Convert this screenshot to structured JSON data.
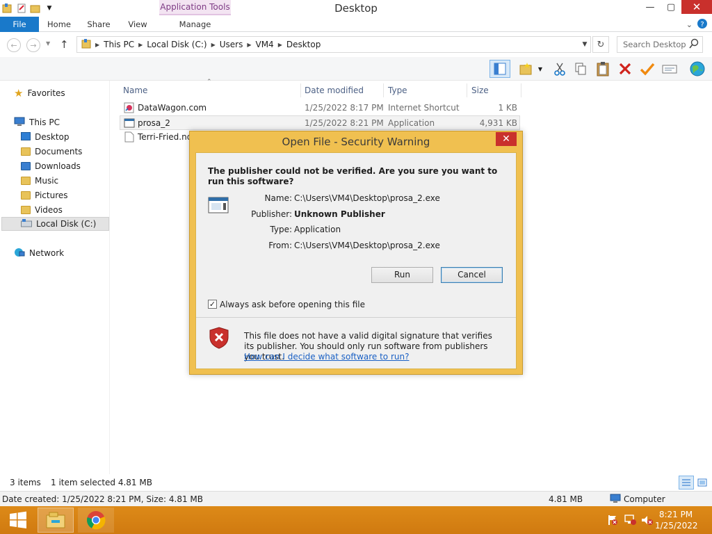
{
  "window": {
    "title": "Desktop",
    "app_tools_label": "Application Tools",
    "controls": {
      "minimize": "—",
      "restore": "▢",
      "close": "✕"
    }
  },
  "ribbon": {
    "tabs": [
      "File",
      "Home",
      "Share",
      "View",
      "Manage"
    ]
  },
  "address": {
    "crumbs": [
      "This PC",
      "Local Disk (C:)",
      "Users",
      "VM4",
      "Desktop"
    ],
    "search_placeholder": "Search Desktop"
  },
  "nav": {
    "favorites": "Favorites",
    "this_pc": "This PC",
    "items": [
      "Desktop",
      "Documents",
      "Downloads",
      "Music",
      "Pictures",
      "Videos",
      "Local Disk (C:)"
    ],
    "network": "Network"
  },
  "files": {
    "headers": [
      "Name",
      "Date modified",
      "Type",
      "Size"
    ],
    "rows": [
      {
        "name": "DataWagon.com",
        "date": "1/25/2022 8:17 PM",
        "type": "Internet Shortcut",
        "size": "1 KB"
      },
      {
        "name": "prosa_2",
        "date": "1/25/2022 8:21 PM",
        "type": "Application",
        "size": "4,931 KB"
      },
      {
        "name": "Terri-Fried.nds",
        "date": "",
        "type": "",
        "size": ""
      }
    ]
  },
  "status": {
    "item_count": "3 items",
    "selection": "1 item selected  4.81 MB",
    "details": "Date created: 1/25/2022 8:21 PM, Size: 4.81 MB",
    "size": "4.81 MB",
    "location": "Computer"
  },
  "taskbar": {
    "time": "8:21 PM",
    "date": "1/25/2022"
  },
  "dialog": {
    "title": "Open File - Security Warning",
    "heading": "The publisher could not be verified.  Are you sure you want to run this software?",
    "fields": [
      {
        "label": "Name:",
        "value": "C:\\Users\\VM4\\Desktop\\prosa_2.exe"
      },
      {
        "label": "Publisher:",
        "value": "Unknown Publisher"
      },
      {
        "label": "Type:",
        "value": "Application"
      },
      {
        "label": "From:",
        "value": "C:\\Users\\VM4\\Desktop\\prosa_2.exe"
      }
    ],
    "run_label": "Run",
    "cancel_label": "Cancel",
    "checkbox_label": "Always ask before opening this file",
    "checkbox_checked": true,
    "warning_text": "This file does not have a valid digital signature that verifies its publisher.  You should only run software from publishers you trust.",
    "help_link": "How can I decide what software to run?"
  }
}
